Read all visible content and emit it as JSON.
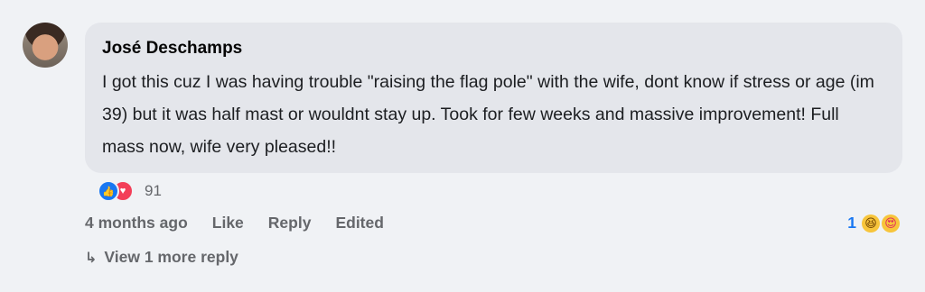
{
  "comment": {
    "author": "José Deschamps",
    "text": "I got this cuz I was having trouble \"raising the flag pole\" with the wife, dont know if stress or age (im 39) but it was half mast or wouldnt stay up. Took for few weeks and massive improvement! Full mass now, wife very pleased!!",
    "reactions": {
      "icons": [
        "like-icon",
        "love-icon"
      ],
      "count": "91"
    },
    "actions": {
      "time": "4 months ago",
      "like": "Like",
      "reply": "Reply",
      "edited": "Edited"
    },
    "reply_reactions": {
      "count": "1",
      "icons": [
        "haha-icon",
        "heart-eyes-icon"
      ]
    },
    "view_more": "View 1 more reply"
  },
  "colors": {
    "background": "#f0f2f5",
    "bubble": "#e4e6eb",
    "accent": "#1877f2",
    "secondary_text": "#65676b"
  }
}
